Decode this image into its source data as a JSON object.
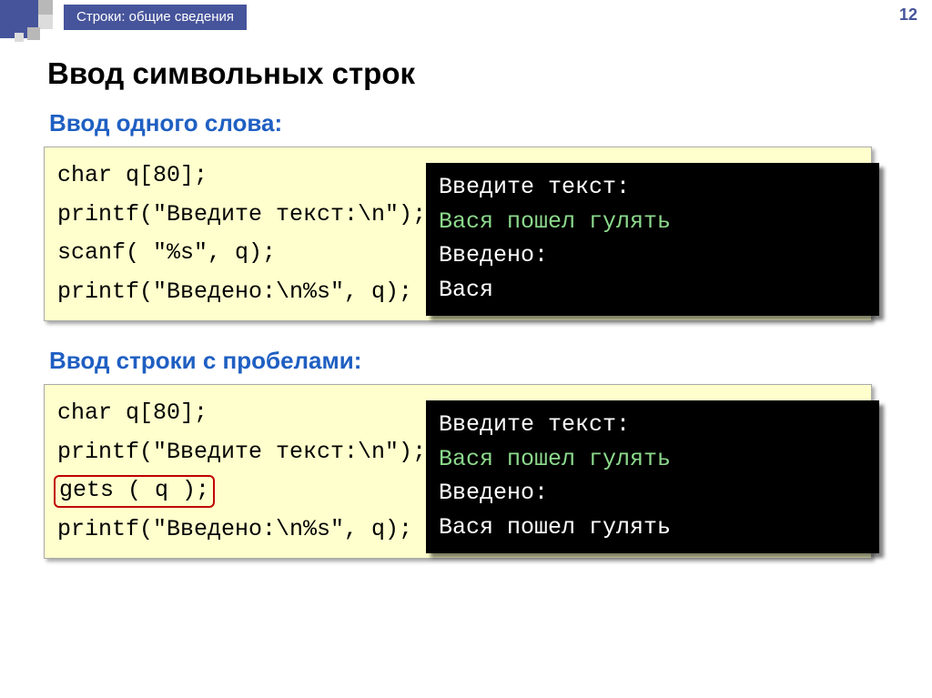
{
  "header": {
    "breadcrumb": "Строки: общие сведения",
    "page_number": "12"
  },
  "title": "Ввод символьных строк",
  "example1": {
    "subtitle": "Ввод одного слова:",
    "code": {
      "l1": "char q[80];",
      "l2": "printf(\"Введите текст:\\n\");",
      "l3": "scanf( \"%s\", q);",
      "l4": "printf(\"Введено:\\n%s\", q);"
    },
    "console": {
      "l1": "Введите текст:",
      "l2": "Вася пошел гулять",
      "l3": "Введено:",
      "l4": "Вася"
    }
  },
  "example2": {
    "subtitle": "Ввод строки с пробелами:",
    "code": {
      "l1": "char q[80];",
      "l2": "printf(\"Введите текст:\\n\");",
      "l3": "gets ( q );",
      "l4": "printf(\"Введено:\\n%s\", q);"
    },
    "console": {
      "l1": "Введите текст:",
      "l2": "Вася пошел гулять",
      "l3": "Введено:",
      "l4": "Вася пошел гулять"
    }
  }
}
